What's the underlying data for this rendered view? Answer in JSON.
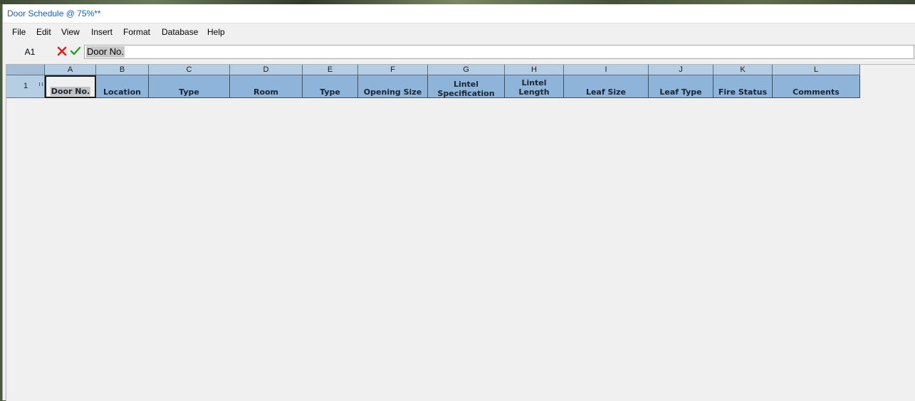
{
  "window": {
    "title": "Door Schedule @ 75%**"
  },
  "menu": [
    "File",
    "Edit",
    "View",
    "Insert",
    "Format",
    "Database",
    "Help"
  ],
  "formula_bar": {
    "cell_ref": "A1",
    "value": "Door No.",
    "cancel_color": "#e02020",
    "confirm_color": "#20a020"
  },
  "sheet": {
    "columns": [
      "A",
      "B",
      "C",
      "D",
      "E",
      "F",
      "G",
      "H",
      "I",
      "J",
      "K",
      "L"
    ],
    "rows": [
      {
        "number": "1",
        "cells": [
          "Door No.",
          "Location",
          "Type",
          "Room",
          "Type",
          "Opening Size",
          "Lintel Specification",
          "Lintel Length",
          "Leaf Size",
          "Leaf Type",
          "Fire Status",
          "Comments"
        ]
      }
    ],
    "active_cell": "A1",
    "colors": {
      "header": "#b6cee4",
      "data_cell": "#8fb4d9",
      "grid": "#3c4f63"
    }
  }
}
